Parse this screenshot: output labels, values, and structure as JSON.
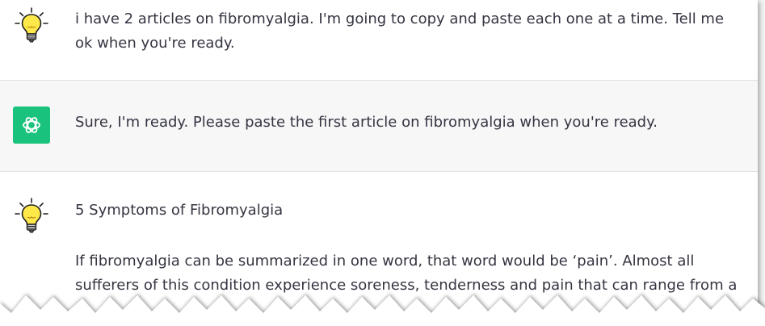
{
  "conversation": {
    "messages": [
      {
        "role": "user",
        "avatar_icon": "lightbulb-icon",
        "text": "i have 2 articles on fibromyalgia. I'm going to copy and paste each one at a time. Tell me ok when you're ready."
      },
      {
        "role": "assistant",
        "avatar_icon": "openai-logo-icon",
        "text": "Sure, I'm ready. Please paste the first article on fibromyalgia when you're ready."
      },
      {
        "role": "user",
        "avatar_icon": "lightbulb-icon",
        "title": "5 Symptoms of Fibromyalgia",
        "text": "If fibromyalgia can be summarized in one word, that word would be ‘pain’. Almost all sufferers of this condition experience soreness, tenderness and pain that can range from a"
      }
    ]
  },
  "colors": {
    "assistant_avatar_bg": "#19c37d",
    "assistant_row_bg": "#f7f7f8",
    "text": "#343541",
    "bulb_yellow": "#ffe84a"
  }
}
